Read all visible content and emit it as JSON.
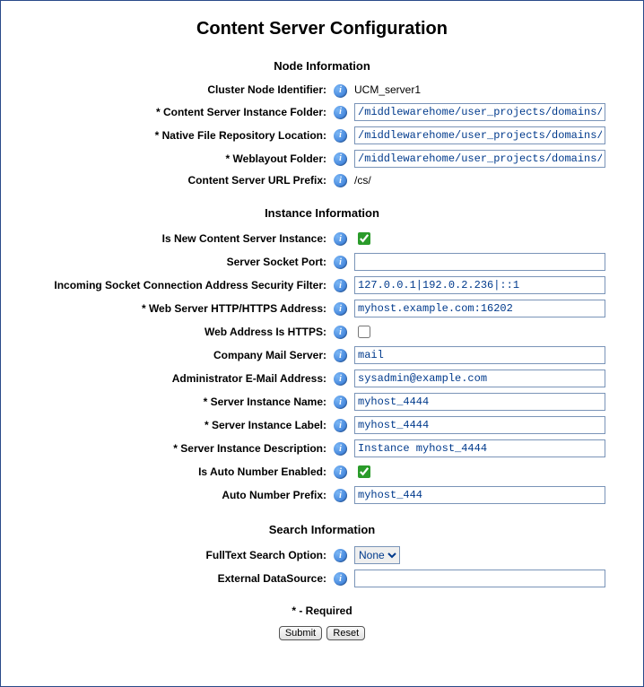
{
  "page_title": "Content Server Configuration",
  "required_note": "* - Required",
  "buttons": {
    "submit": "Submit",
    "reset": "Reset"
  },
  "sections": {
    "node": {
      "heading": "Node Information",
      "cluster_node_identifier": {
        "label": "Cluster Node Identifier:",
        "value": "UCM_server1"
      },
      "content_server_instance_folder": {
        "label": "* Content Server Instance Folder:",
        "value": "/middlewarehome/user_projects/domains/test_"
      },
      "native_file_repository_location": {
        "label": "* Native File Repository Location:",
        "value": "/middlewarehome/user_projects/domains/test_"
      },
      "weblayout_folder": {
        "label": "* Weblayout Folder:",
        "value": "/middlewarehome/user_projects/domains/test_"
      },
      "url_prefix": {
        "label": "Content Server URL Prefix:",
        "value": "/cs/"
      }
    },
    "instance": {
      "heading": "Instance Information",
      "is_new_instance": {
        "label": "Is New Content Server Instance:",
        "checked": true
      },
      "server_socket_port": {
        "label": "Server Socket Port:",
        "value": ""
      },
      "security_filter": {
        "label": "Incoming Socket Connection Address Security Filter:",
        "value": "127.0.0.1|192.0.2.236|::1"
      },
      "web_server_address": {
        "label": "* Web Server HTTP/HTTPS Address:",
        "value": "myhost.example.com:16202"
      },
      "web_address_is_https": {
        "label": "Web Address Is HTTPS:",
        "checked": false
      },
      "company_mail_server": {
        "label": "Company Mail Server:",
        "value": "mail"
      },
      "admin_email": {
        "label": "Administrator E-Mail Address:",
        "value": "sysadmin@example.com"
      },
      "server_instance_name": {
        "label": "* Server Instance Name:",
        "value": "myhost_4444"
      },
      "server_instance_label": {
        "label": "* Server Instance Label:",
        "value": "myhost_4444"
      },
      "server_instance_description": {
        "label": "* Server Instance Description:",
        "value": "Instance myhost_4444"
      },
      "auto_number_enabled": {
        "label": "Is Auto Number Enabled:",
        "checked": true
      },
      "auto_number_prefix": {
        "label": "Auto Number Prefix:",
        "value": "myhost_444"
      }
    },
    "search": {
      "heading": "Search Information",
      "fulltext_search_option": {
        "label": "FullText Search Option:",
        "value": "None",
        "options": [
          "None"
        ]
      },
      "external_datasource": {
        "label": "External DataSource:",
        "value": ""
      }
    }
  }
}
